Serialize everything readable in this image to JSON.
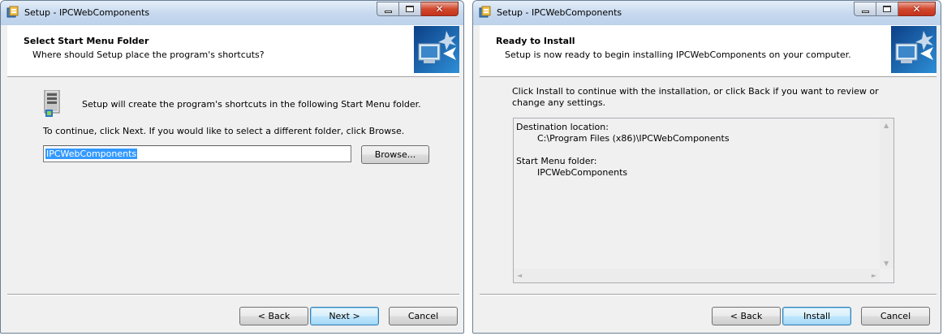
{
  "left_window": {
    "title": "Setup - IPCWebComponents",
    "header": {
      "title": "Select Start Menu Folder",
      "subtitle": "Where should Setup place the program's shortcuts?"
    },
    "info_text": "Setup will create the program's shortcuts in the following Start Menu folder.",
    "instruction_text": "To continue, click Next. If you would like to select a different folder, click Browse.",
    "folder_input_value": "IPCWebComponents",
    "browse_label": "Browse...",
    "back_label": "< Back",
    "next_label": "Next >",
    "cancel_label": "Cancel"
  },
  "right_window": {
    "title": "Setup - IPCWebComponents",
    "header": {
      "title": "Ready to Install",
      "subtitle": "Setup is now ready to begin installing IPCWebComponents on your computer."
    },
    "instruction_line1": "Click Install to continue with the installation, or click Back if you want to review or",
    "instruction_line2": "change any settings.",
    "memo": {
      "dest_label": "Destination location:",
      "dest_value": "C:\\Program Files (x86)\\IPCWebComponents",
      "startmenu_label": "Start Menu folder:",
      "startmenu_value": "IPCWebComponents"
    },
    "back_label": "< Back",
    "install_label": "Install",
    "cancel_label": "Cancel"
  },
  "icons": {
    "minimize": "minimize-icon",
    "maximize": "maximize-icon",
    "close": "close-icon",
    "close_glyph": "✕",
    "scroll_up": "▲",
    "scroll_down": "▼",
    "scroll_left": "◄",
    "scroll_right": "►"
  },
  "colors": {
    "selection": "#3399ff",
    "default_button_border": "#3c7fb1",
    "close_button": "#c4321c"
  }
}
